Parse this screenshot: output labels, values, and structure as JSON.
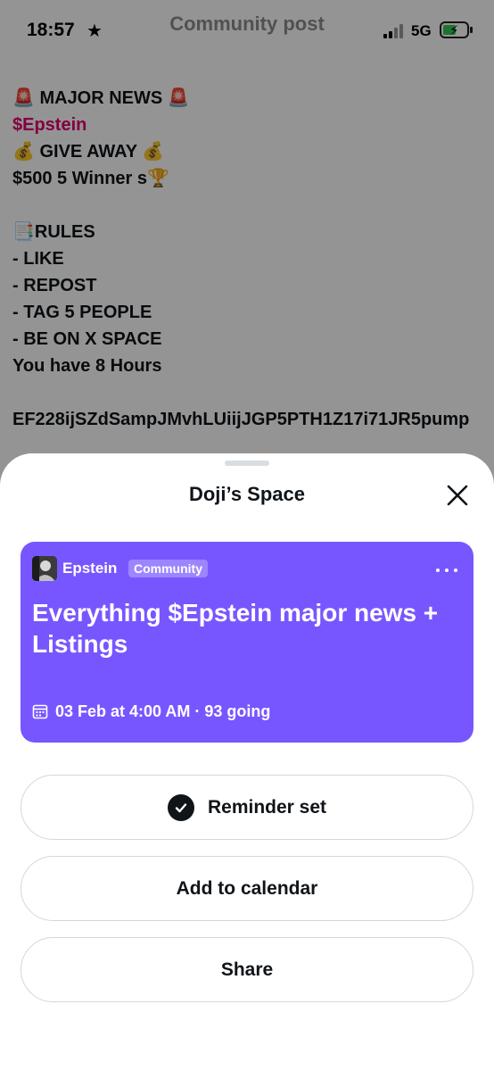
{
  "status_bar": {
    "time": "18:57",
    "network": "5G",
    "faded_title": "Community post"
  },
  "post": {
    "lines": [
      {
        "text": "🚨 MAJOR NEWS 🚨",
        "highlight": false
      },
      {
        "text": "$Epstein",
        "highlight": true
      },
      {
        "text": "💰 GIVE AWAY 💰",
        "highlight": false
      },
      {
        "text": " $500 5 Winner s🏆",
        "highlight": false
      },
      {
        "text": "",
        "highlight": false
      },
      {
        "text": "📑RULES",
        "highlight": false
      },
      {
        "text": "- LIKE",
        "highlight": false
      },
      {
        "text": "- REPOST",
        "highlight": false
      },
      {
        "text": "- TAG 5 PEOPLE",
        "highlight": false
      },
      {
        "text": "- BE ON X SPACE",
        "highlight": false
      },
      {
        "text": "You have 8 Hours",
        "highlight": false
      },
      {
        "text": "",
        "highlight": false
      }
    ],
    "address": "EF228ijSZdSampJMvhLUiijJGP5PTH1Z17i71JR5pump"
  },
  "sheet": {
    "title": "Doji’s Space",
    "card": {
      "host": "Epstein",
      "badge": "Community",
      "title": "Everything $Epstein major news + Listings",
      "meta": "03 Feb at 4:00 AM · 93 going"
    },
    "buttons": {
      "reminder": "Reminder set",
      "calendar": "Add to calendar",
      "share": "Share"
    }
  },
  "colors": {
    "card_bg": "#7856ff",
    "highlight_text": "#e0006c",
    "battery_fill": "#34c759",
    "button_border": "#cfd9de"
  },
  "icons": [
    "star-icon",
    "signal-icon",
    "battery-icon",
    "close-icon",
    "more-icon",
    "calendar-icon",
    "check-icon"
  ]
}
